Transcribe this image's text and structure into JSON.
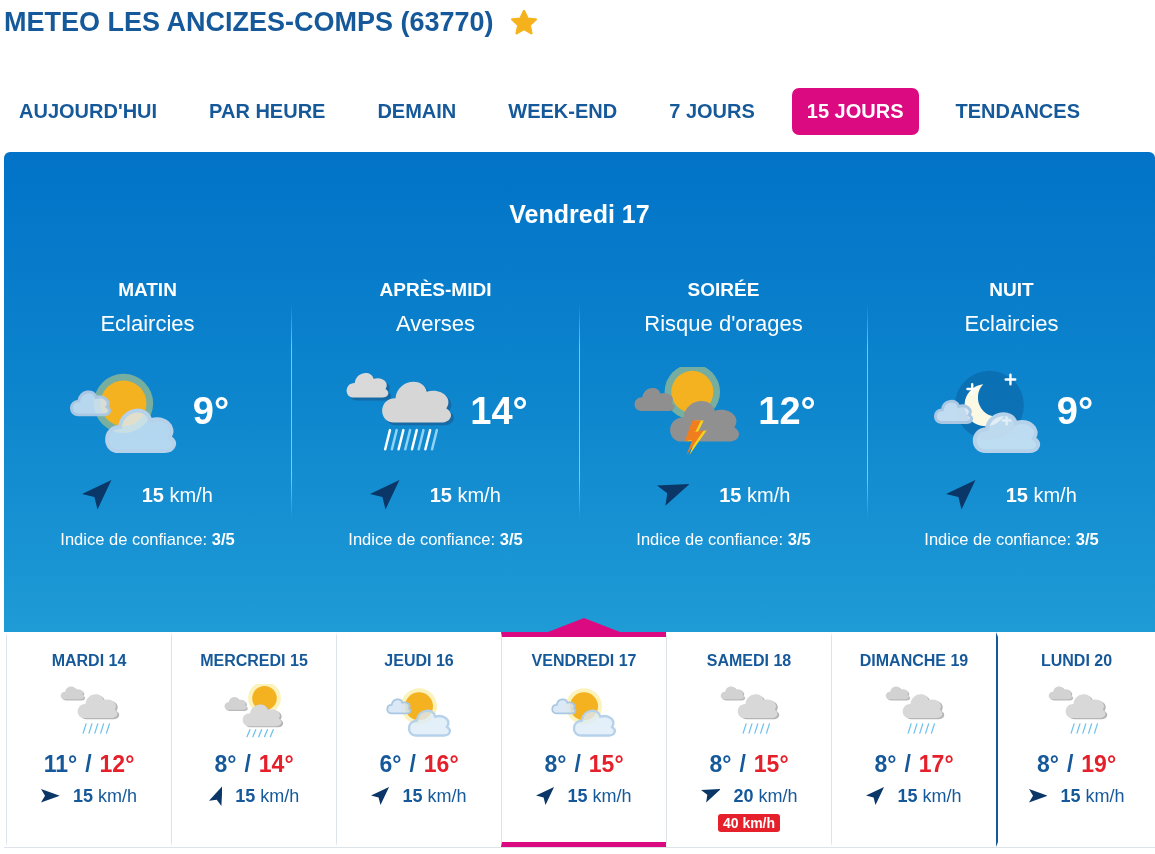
{
  "header": {
    "title": "METEO LES ANCIZES-COMPS (63770)",
    "favorite": true
  },
  "tabs": [
    {
      "label": "AUJOURD'HUI",
      "selected": false
    },
    {
      "label": "PAR HEURE",
      "selected": false
    },
    {
      "label": "DEMAIN",
      "selected": false
    },
    {
      "label": "WEEK-END",
      "selected": false
    },
    {
      "label": "7 JOURS",
      "selected": false
    },
    {
      "label": "15 JOURS",
      "selected": true
    },
    {
      "label": "TENDANCES",
      "selected": false
    }
  ],
  "day_detail": {
    "title": "Vendredi 17",
    "periods": [
      {
        "label": "MATIN",
        "condition": "Eclaircies",
        "kind": "sun-cloud",
        "temperature": "9°",
        "wind": {
          "kind": "NE",
          "speed": "**15** km/h"
        },
        "confidence": "Indice de confiance: **3/5**"
      },
      {
        "label": "APRÈS-MIDI",
        "condition": "Averses",
        "kind": "showers",
        "temperature": "14°",
        "wind": {
          "kind": "NE",
          "speed": "**15** km/h"
        },
        "confidence": "Indice de confiance: **3/5**"
      },
      {
        "label": "SOIRÉE",
        "condition": "Risque d'orages",
        "kind": "storm",
        "temperature": "12°",
        "wind": {
          "kind": "ENE",
          "speed": "**15** km/h"
        },
        "confidence": "Indice de confiance: **3/5**"
      },
      {
        "label": "NUIT",
        "condition": "Eclaircies",
        "kind": "moon-cloud",
        "temperature": "9°",
        "wind": {
          "kind": "NE",
          "speed": "**15** km/h"
        },
        "confidence": "Indice de confiance: **3/5**"
      }
    ]
  },
  "days": [
    {
      "name": "MARDI 14",
      "kind": "rain",
      "low": "11°",
      "separator": "/",
      "high": "12°",
      "wind": {
        "kind": "E",
        "speed": "**15** km/h"
      },
      "selected": false,
      "week_start": false
    },
    {
      "name": "MERCREDI 15",
      "kind": "sun-rain",
      "low": "8°",
      "separator": "/",
      "high": "14°",
      "wind": {
        "kind": "NNE",
        "speed": "**15** km/h"
      },
      "selected": false,
      "week_start": false
    },
    {
      "name": "JEUDI 16",
      "kind": "sun-cloud",
      "low": "6°",
      "separator": "/",
      "high": "16°",
      "wind": {
        "kind": "NE",
        "speed": "**15** km/h"
      },
      "selected": false,
      "week_start": false
    },
    {
      "name": "VENDREDI 17",
      "kind": "sun-cloud",
      "low": "8°",
      "separator": "/",
      "high": "15°",
      "wind": {
        "kind": "NE",
        "speed": "**15** km/h"
      },
      "selected": true,
      "week_start": false
    },
    {
      "name": "SAMEDI 18",
      "kind": "rain",
      "low": "8°",
      "separator": "/",
      "high": "15°",
      "wind": {
        "kind": "ENE",
        "speed": "**20** km/h"
      },
      "gust": "40 km/h",
      "selected": false,
      "week_start": false
    },
    {
      "name": "DIMANCHE 19",
      "kind": "rain",
      "low": "8°",
      "separator": "/",
      "high": "17°",
      "wind": {
        "kind": "NE",
        "speed": "**15** km/h"
      },
      "selected": false,
      "week_start": false
    },
    {
      "name": "LUNDI 20",
      "kind": "rain",
      "low": "8°",
      "separator": "/",
      "high": "19°",
      "wind": {
        "kind": "E",
        "speed": "**15** km/h"
      },
      "selected": false,
      "week_start": true
    }
  ]
}
